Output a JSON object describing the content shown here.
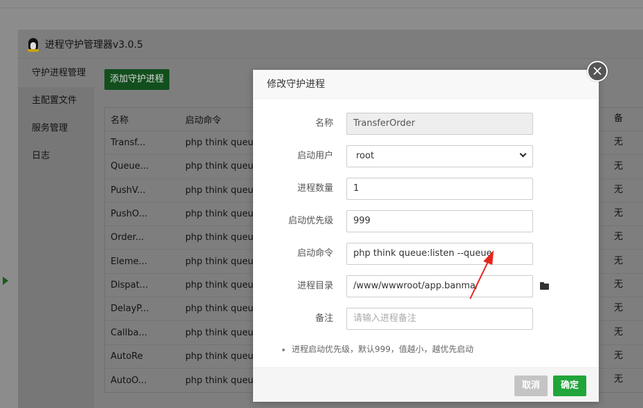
{
  "window": {
    "title": "进程守护管理器v3.0.5"
  },
  "sidebar": {
    "items": [
      {
        "label": "守护进程管理"
      },
      {
        "label": "主配置文件"
      },
      {
        "label": "服务管理"
      },
      {
        "label": "日志"
      }
    ]
  },
  "main": {
    "add_button": "添加守护进程",
    "table": {
      "headers": [
        "名称",
        "启动命令"
      ],
      "note_header": "备",
      "rows": [
        {
          "name": "Transf...",
          "cmd": "php think queu.",
          "note": "无"
        },
        {
          "name": "Queue...",
          "cmd": "php think queu.",
          "note": "无"
        },
        {
          "name": "PushV...",
          "cmd": "php think queu.",
          "note": "无"
        },
        {
          "name": "PushO...",
          "cmd": "php think queu.",
          "note": "无"
        },
        {
          "name": "Order...",
          "cmd": "php think queu.",
          "note": "无"
        },
        {
          "name": "Eleme...",
          "cmd": "php think queu.",
          "note": "无"
        },
        {
          "name": "Dispat...",
          "cmd": "php think queu.",
          "note": "无"
        },
        {
          "name": "DelayP...",
          "cmd": "php think queu.",
          "note": "无"
        },
        {
          "name": "Callba...",
          "cmd": "php think queu.",
          "note": "无"
        },
        {
          "name": "AutoRe",
          "cmd": "php think queu.",
          "note": "无"
        },
        {
          "name": "AutoO...",
          "cmd": "php think queu.",
          "note": "无"
        }
      ]
    }
  },
  "modal": {
    "title": "修改守护进程",
    "close": "×",
    "fields": {
      "name": {
        "label": "名称",
        "value": "TransferOrder"
      },
      "user": {
        "label": "启动用户",
        "value": "root"
      },
      "count": {
        "label": "进程数量",
        "value": "1"
      },
      "priority": {
        "label": "启动优先级",
        "value": "999"
      },
      "command": {
        "label": "启动命令",
        "value": "php think queue:listen --queue"
      },
      "dir": {
        "label": "进程目录",
        "value": "/www/wwwroot/app.banma/"
      },
      "note": {
        "label": "备注",
        "placeholder": "请输入进程备注"
      }
    },
    "hint": "进程启动优先级，默认999，值越小，越优先启动",
    "cancel": "取消",
    "ok": "确定"
  },
  "colors": {
    "accent": "#20a53a",
    "annotation_arrow": "#e8241c"
  }
}
